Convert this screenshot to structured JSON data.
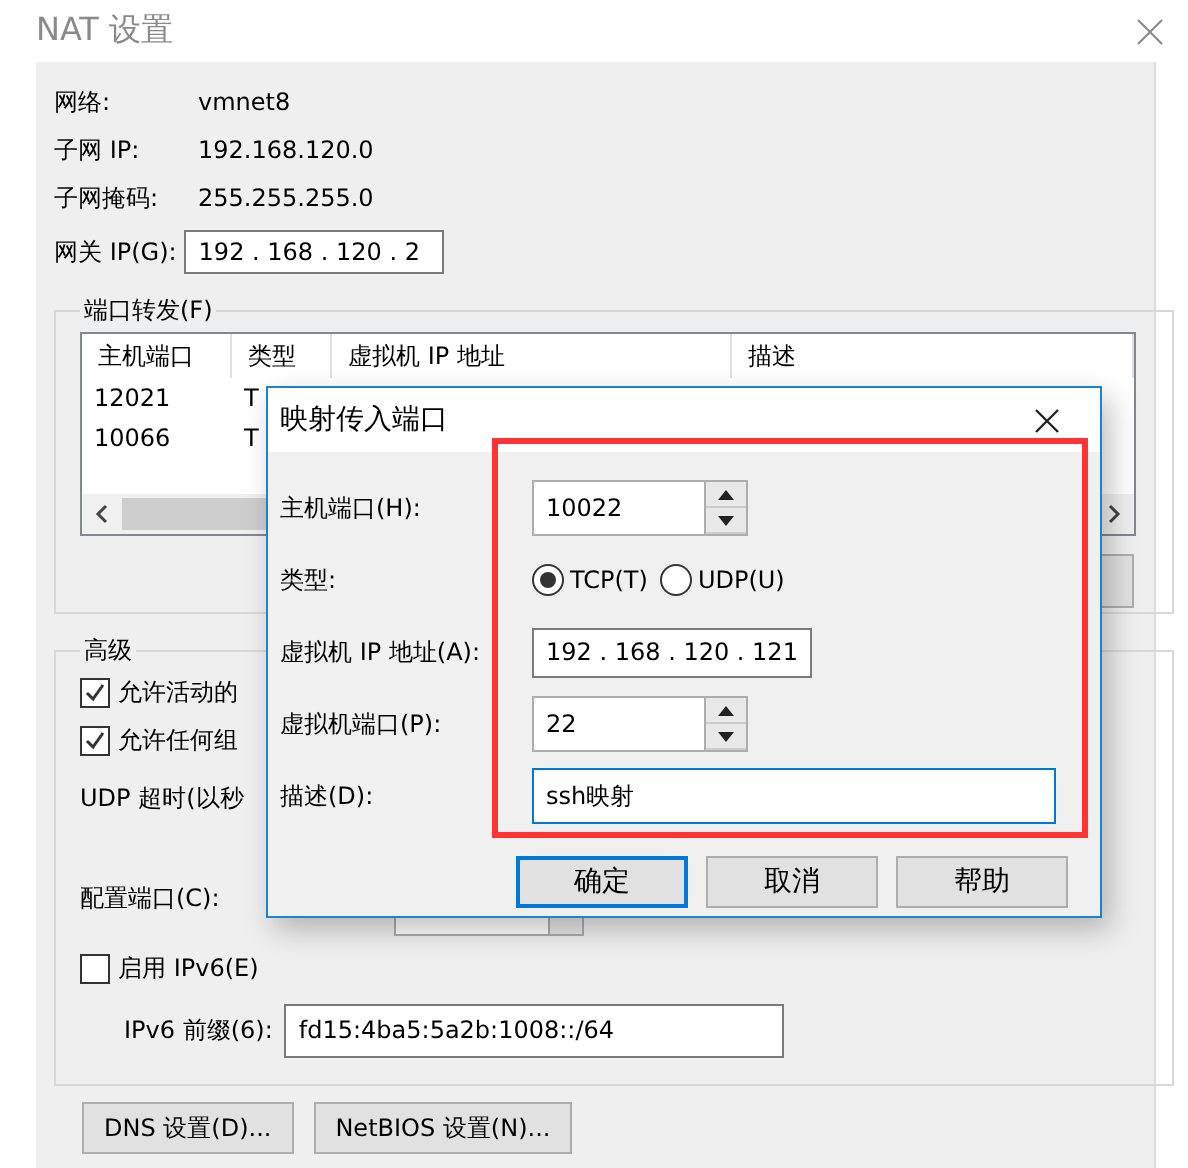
{
  "window": {
    "title": "NAT 设置"
  },
  "info": [
    {
      "label": "网络:",
      "value": "vmnet8"
    },
    {
      "label": "子网 IP:",
      "value": "192.168.120.0"
    },
    {
      "label": "子网掩码:",
      "value": "255.255.255.0"
    }
  ],
  "gateway": {
    "label": "网关 IP(G):",
    "value": "192 . 168 . 120 .  2"
  },
  "port_forwarding": {
    "title": "端口转发(F)",
    "columns": [
      "主机端口",
      "类型",
      "虚拟机 IP 地址",
      "描述"
    ],
    "rows": [
      [
        "12021",
        "T"
      ],
      [
        "10066",
        "T"
      ]
    ]
  },
  "advanced": {
    "title": "高级",
    "checkboxes": [
      {
        "label": "允许活动的",
        "checked": true
      },
      {
        "label": "允许任何组",
        "checked": true
      }
    ],
    "udp_timeout_label": "UDP 超时(以秒",
    "config_port_label": "配置端口(C):",
    "ipv6": {
      "label": "启用 IPv6(E)",
      "checked": false
    },
    "ipv6_prefix": {
      "label": "IPv6 前缀(6):",
      "value": "fd15:4ba5:5a2b:1008::/64"
    }
  },
  "buttons": [
    "DNS 设置(D)...",
    "NetBIOS 设置(N)..."
  ],
  "dialog": {
    "title": "映射传入端口",
    "host_port": {
      "label": "主机端口(H):",
      "value": "10022"
    },
    "type": {
      "label": "类型:",
      "options": [
        {
          "label": "TCP(T)",
          "selected": true
        },
        {
          "label": "UDP(U)",
          "selected": false
        }
      ]
    },
    "vm_ip": {
      "label": "虚拟机 IP 地址(A):",
      "value": "192 . 168 . 120 . 121"
    },
    "vm_port": {
      "label": "虚拟机端口(P):",
      "value": "22"
    },
    "description": {
      "label": "描述(D):",
      "value": "ssh映射"
    },
    "buttons": [
      {
        "label": "确定",
        "default": true
      },
      {
        "label": "取消",
        "default": false
      },
      {
        "label": "帮助",
        "default": false
      }
    ]
  }
}
